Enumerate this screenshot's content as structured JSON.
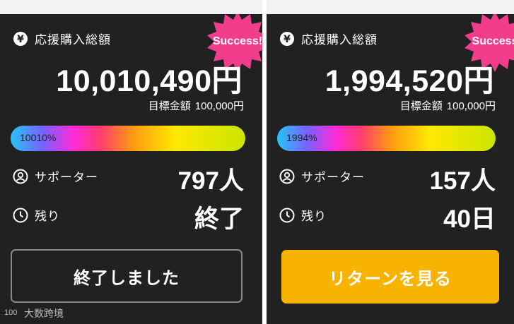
{
  "colors": {
    "card_bg": "#212121",
    "badge": "#f23d8c",
    "button_return": "#f8b200",
    "button_ended_border": "#8a8a8a"
  },
  "icons": {
    "amount": "yen-circle-icon",
    "supporters": "user-circle-icon",
    "remaining": "clock-icon",
    "badge": "starburst-badge"
  },
  "cards": [
    {
      "badge": "Success!",
      "amount_label": "応援購入総額",
      "amount": "10,010,490円",
      "target_label": "目標金額",
      "target_value": "100,000円",
      "progress_percent": 10010,
      "progress_label": "10010%",
      "supporters_label": "サポーター",
      "supporters_value": "797人",
      "remaining_label": "残り",
      "remaining_value": "終了",
      "button_label": "終了しました"
    },
    {
      "badge": "Success",
      "amount_label": "応援購入総額",
      "amount": "1,994,520円",
      "target_label": "目標金額",
      "target_value": "100,000円",
      "progress_percent": 1994,
      "progress_label": "1994%",
      "supporters_label": "サポーター",
      "supporters_value": "157人",
      "remaining_label": "残り",
      "remaining_value": "40日",
      "button_label": "リターンを見る"
    }
  ],
  "watermark": {
    "logo_text": "100",
    "text": "大数跨境"
  }
}
